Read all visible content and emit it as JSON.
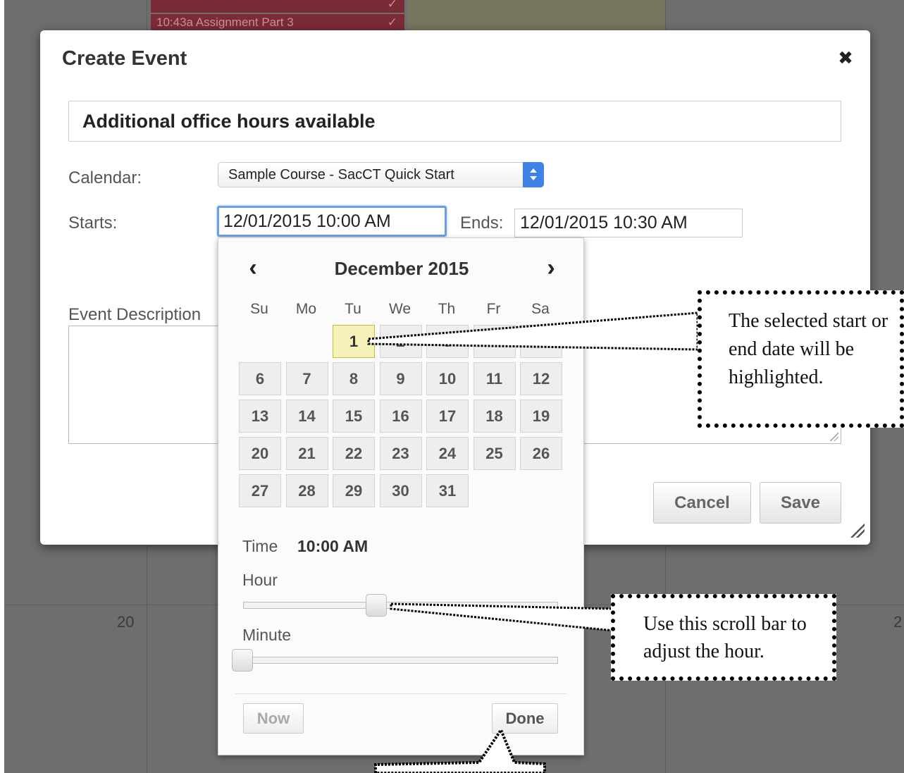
{
  "background": {
    "events": [
      "10:43a Assignment Part 3"
    ],
    "day_numbers": [
      "20",
      "2"
    ]
  },
  "dialog": {
    "title": "Create Event",
    "title_value": "Additional office hours available",
    "calendar_label": "Calendar:",
    "calendar_value": "Sample Course - SacCT Quick Start",
    "starts_label": "Starts:",
    "starts_value": "12/01/2015 10:00 AM",
    "ends_label": "Ends:",
    "ends_value": "12/01/2015 10:30 AM",
    "description_label": "Event Description",
    "cancel_label": "Cancel",
    "save_label": "Save"
  },
  "datepicker": {
    "month_label": "December 2015",
    "weekdays": [
      "Su",
      "Mo",
      "Tu",
      "We",
      "Th",
      "Fr",
      "Sa"
    ],
    "days": [
      "1",
      "2",
      "3",
      "4",
      "5",
      "6",
      "7",
      "8",
      "9",
      "10",
      "11",
      "12",
      "13",
      "14",
      "15",
      "16",
      "17",
      "18",
      "19",
      "20",
      "21",
      "22",
      "23",
      "24",
      "25",
      "26",
      "27",
      "28",
      "29",
      "30",
      "31"
    ],
    "first_weekday_index": 2,
    "selected_day": "1",
    "time_label": "Time",
    "time_value": "10:00 AM",
    "hour_label": "Hour",
    "minute_label": "Minute",
    "hour_fraction": 0.4167,
    "minute_fraction": 0,
    "now_label": "Now",
    "done_label": "Done"
  },
  "callouts": {
    "highlight_text": "The selected start or end date will be highlighted.",
    "scroll_text": "Use this scroll bar to adjust the hour."
  },
  "colors": {
    "selected_day": "#f6f1b8",
    "select_accent": "#3e82e8",
    "focus_border": "#6b9ee8"
  }
}
